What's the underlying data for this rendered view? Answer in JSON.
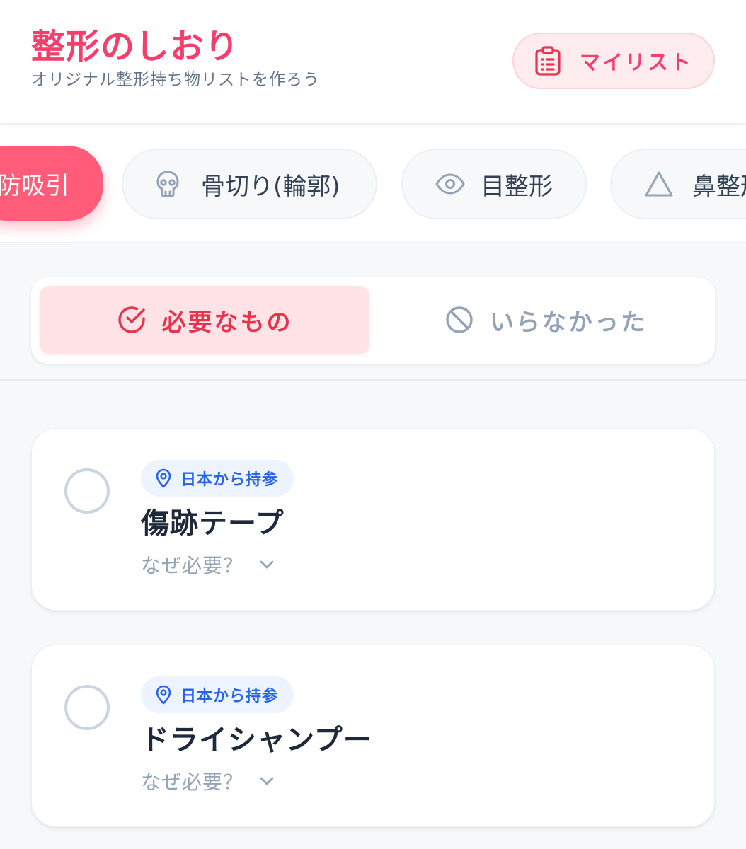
{
  "header": {
    "title": "整形のしおり",
    "subtitle": "オリジナル整形持ち物リストを作ろう",
    "mylist_label": "マイリスト"
  },
  "categories": [
    {
      "label": "防吸引",
      "icon": "none",
      "active": true
    },
    {
      "label": "骨切り(輪郭)",
      "icon": "skull-icon",
      "active": false
    },
    {
      "label": "目整形",
      "icon": "eye-icon",
      "active": false
    },
    {
      "label": "鼻整形",
      "icon": "triangle-icon",
      "active": false
    }
  ],
  "toggle": {
    "needed_label": "必要なもの",
    "unneeded_label": "いらなかった",
    "selected": "needed"
  },
  "items": [
    {
      "tag": "日本から持参",
      "name": "傷跡テープ",
      "why_label": "なぜ必要？",
      "checked": false
    },
    {
      "tag": "日本から持参",
      "name": "ドライシャンプー",
      "why_label": "なぜ必要？",
      "checked": false
    }
  ],
  "colors": {
    "brand": "#f43f6c",
    "active_chip": "#fe5c79",
    "tag_text": "#2563eb",
    "muted": "#94a3b8"
  }
}
